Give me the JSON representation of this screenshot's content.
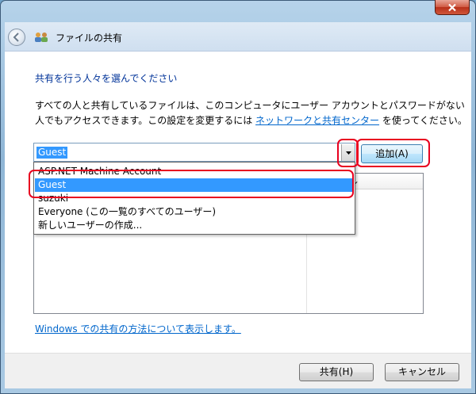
{
  "window": {
    "title": "ファイルの共有"
  },
  "heading": "共有を行う人々を選んでください",
  "description": {
    "line1": "すべての人と共有しているファイルは、このコンピュータにユーザー アカウントとパスワードがない",
    "line2_before": "人でもアクセスできます。この設定を変更するには",
    "line2_link": "ネットワークと共有センター",
    "line2_after": "を使ってください。"
  },
  "combo": {
    "value": "Guest"
  },
  "add_button": "追加(A)",
  "dropdown": {
    "items": [
      "ASP.NET Machine Account",
      "Guest",
      "suzuki",
      "Everyone (この一覧のすべてのユーザー)",
      "新しいユーザーの作成..."
    ],
    "selected_index": 1
  },
  "list": {
    "column_partial": "可のレベル"
  },
  "help_link": "Windows での共有の方法について表示します。",
  "buttons": {
    "share": "共有(H)",
    "cancel": "キャンセル"
  },
  "colors": {
    "highlight": "#e8001f",
    "selection": "#3399ff",
    "heading": "#003399",
    "link": "#0066cc"
  }
}
